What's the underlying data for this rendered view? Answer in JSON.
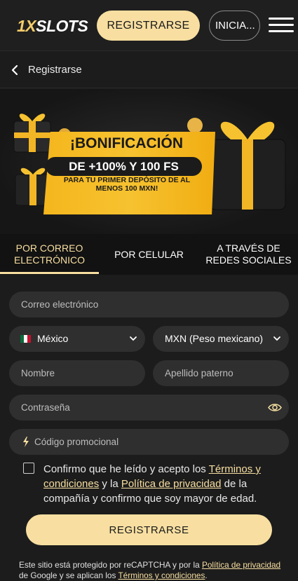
{
  "header": {
    "logo_prefix": "1X",
    "logo_suffix": "SLOTS",
    "register_label": "REGISTRARSE",
    "login_label": "INICIA..."
  },
  "nav": {
    "back_title": "Registrarse"
  },
  "banner": {
    "title": "¡BONIFICACIÓN",
    "highlight": "DE +100% Y 100 FS",
    "subtitle": "PARA TU PRIMER DEPÓSITO DE AL MENOS 100 MXN!"
  },
  "tabs": [
    {
      "label": "POR CORREO ELECTRÓNICO",
      "active": true
    },
    {
      "label": "POR CELULAR",
      "active": false
    },
    {
      "label": "A TRAVÉS DE REDES SOCIALES",
      "active": false
    }
  ],
  "form": {
    "email_placeholder": "Correo electrónico",
    "country_value": "México",
    "currency_value": "MXN (Peso mexicano)",
    "name_placeholder": "Nombre",
    "surname_placeholder": "Apellido paterno",
    "password_placeholder": "Contraseña",
    "promo_placeholder": "Código promocional",
    "consent_part1": "Confirmo que he leído y acepto los ",
    "consent_link_terms": "Términos y condiciones",
    "consent_part2": " y la ",
    "consent_link_privacy": "Política de privacidad",
    "consent_part3": " de la compañía y confirmo que soy mayor de edad.",
    "submit_label": "REGISTRARSE"
  },
  "recaptcha": {
    "part1": "Este sitio está protegido por reCAPTCHA y por la ",
    "link_privacy": "Política de privacidad",
    "part2": " de Google y se aplican los ",
    "link_terms": "Términos y condiciones",
    "part3": "."
  },
  "colors": {
    "accent": "#f8dfa1",
    "background": "#1c1c1c",
    "field": "#2f2f2f",
    "banner_gold": "#f6c230"
  },
  "icons": {
    "back": "chevron-left-icon",
    "menu": "hamburger-menu-icon",
    "dropdown": "chevron-down-icon",
    "password_toggle": "eye-icon",
    "promo": "lightning-bolt-icon",
    "country_flag": "mexico-flag-icon"
  }
}
